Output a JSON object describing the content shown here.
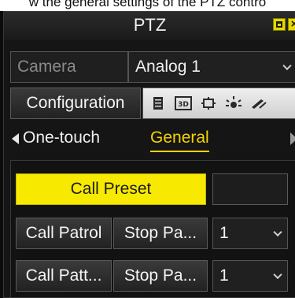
{
  "caption": "w the general settings of the PTZ contro",
  "window": {
    "title": "PTZ"
  },
  "camera": {
    "label": "Camera",
    "value": "Analog 1"
  },
  "configuration": {
    "label": "Configuration",
    "toolbar_icons": [
      "list-icon",
      "3d-icon",
      "focus-frame-icon",
      "light-icon",
      "wiper-icon"
    ]
  },
  "tabs": [
    {
      "label": "One-touch",
      "active": false
    },
    {
      "label": "General",
      "active": true
    }
  ],
  "panel": {
    "call_preset": "Call Preset",
    "patrol": {
      "call": "Call Patrol",
      "stop": "Stop Pa...",
      "value": "1"
    },
    "pattern": {
      "call": "Call Patt...",
      "stop": "Stop Pa...",
      "value": "1"
    }
  },
  "colors": {
    "accent": "#f4d400",
    "primary_button": "#f7ea00",
    "background": "#151515"
  }
}
